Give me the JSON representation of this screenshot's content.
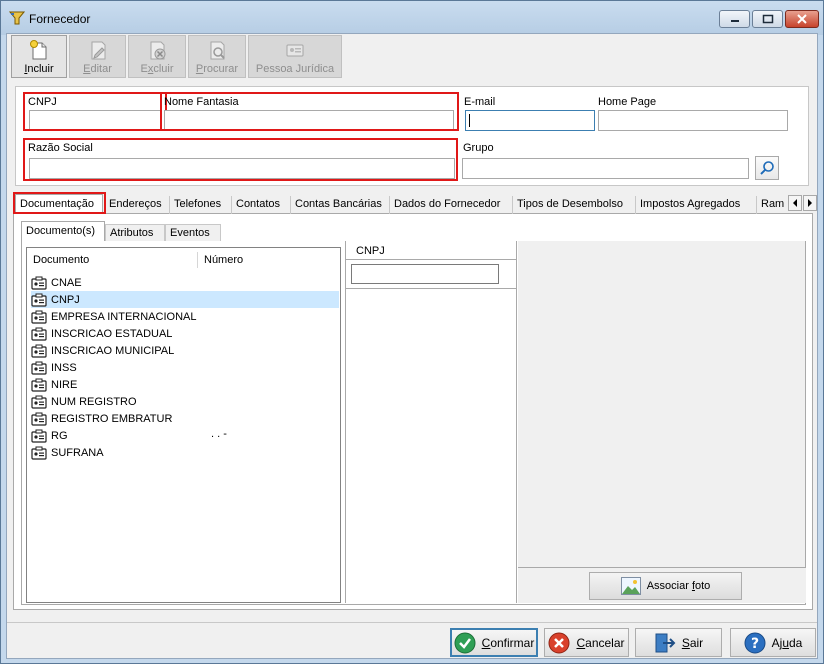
{
  "window": {
    "title": "Fornecedor",
    "controls": {
      "minimize": "minimize",
      "maximize": "maximize",
      "close": "close"
    }
  },
  "toolbar": {
    "buttons": [
      {
        "label": "Incluir",
        "mnemonic": "I",
        "rest": "ncluir",
        "enabled": true,
        "icon": "new-document-icon"
      },
      {
        "label": "Editar",
        "mnemonic": "E",
        "rest": "ditar",
        "enabled": false,
        "icon": "edit-icon"
      },
      {
        "label": "Excluir",
        "mnemonic": "x",
        "pre": "E",
        "rest": "cluir",
        "enabled": false,
        "icon": "delete-icon"
      },
      {
        "label": "Procurar",
        "mnemonic": "P",
        "rest": "rocurar",
        "enabled": false,
        "icon": "search-document-icon"
      },
      {
        "label": "Pessoa Jurídica",
        "enabled": false,
        "icon": "id-card-icon"
      }
    ]
  },
  "form": {
    "cnpj_label": "CNPJ",
    "cnpj_value": "",
    "nome_fantasia_label": "Nome Fantasia",
    "nome_fantasia_value": "",
    "email_label": "E-mail",
    "email_value": "",
    "home_page_label": "Home Page",
    "home_page_value": "",
    "razao_social_label": "Razão Social",
    "razao_social_value": "",
    "grupo_label": "Grupo",
    "grupo_value": ""
  },
  "tabs": [
    "Documentação",
    "Endereços",
    "Telefones",
    "Contatos",
    "Contas Bancárias",
    "Dados do Fornecedor",
    "Tipos de Desembolso",
    "Impostos Agregados",
    "Ram"
  ],
  "subtabs": [
    "Documento(s)",
    "Atributos",
    "Eventos"
  ],
  "documents": {
    "col_documento": "Documento",
    "col_numero": "Número",
    "rows": [
      {
        "name": "CNAE",
        "number": ""
      },
      {
        "name": "CNPJ",
        "number": ""
      },
      {
        "name": "EMPRESA INTERNACIONAL",
        "number": ""
      },
      {
        "name": "INSCRICAO ESTADUAL",
        "number": ""
      },
      {
        "name": "INSCRICAO MUNICIPAL",
        "number": ""
      },
      {
        "name": "INSS",
        "number": ""
      },
      {
        "name": "NIRE",
        "number": ""
      },
      {
        "name": "NUM REGISTRO",
        "number": ""
      },
      {
        "name": "REGISTRO EMBRATUR",
        "number": ""
      },
      {
        "name": "RG",
        "number": ".   .   -"
      },
      {
        "name": "SUFRANA",
        "number": ""
      }
    ],
    "selected_index": 1
  },
  "detail": {
    "header": "CNPJ",
    "value": ""
  },
  "photo": {
    "button_pre": "Associar ",
    "button_mnemonic": "f",
    "button_rest": "oto"
  },
  "footer": {
    "confirmar": {
      "mnemonic": "C",
      "rest": "onfirmar"
    },
    "cancelar": {
      "mnemonic": "C",
      "rest": "ancelar"
    },
    "sair": {
      "mnemonic": "S",
      "rest": "air"
    },
    "ajuda": {
      "pre": "Aj",
      "mnemonic": "u",
      "rest": "da"
    }
  },
  "colors": {
    "highlight": "#e01818",
    "selection": "#cce8ff",
    "focus": "#3c7fb1"
  }
}
